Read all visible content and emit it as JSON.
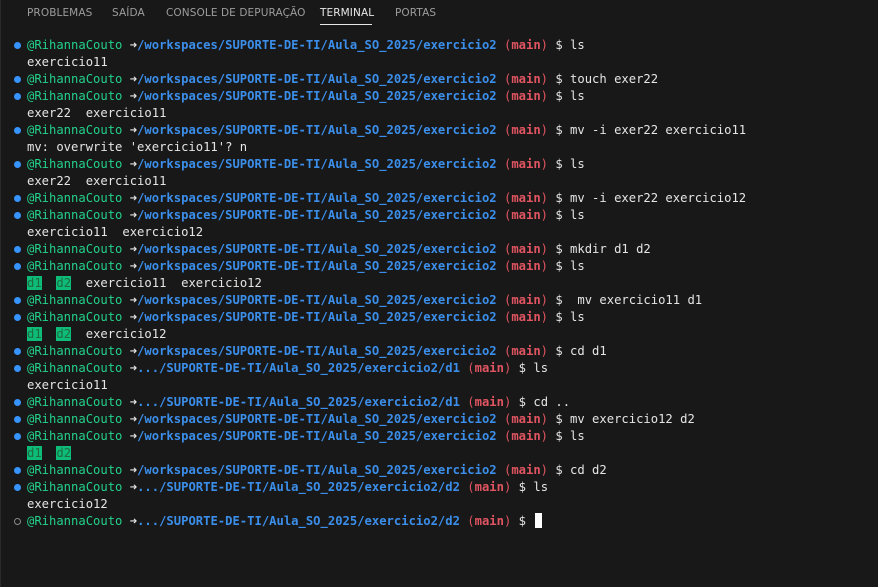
{
  "panel": {
    "tabs": [
      {
        "label": "PROBLEMAS"
      },
      {
        "label": "SAÍDA"
      },
      {
        "label": "CONSOLE DE DEPURAÇÃO"
      },
      {
        "label": "TERMINAL"
      },
      {
        "label": "PORTAS"
      }
    ],
    "active_tab": "TERMINAL"
  },
  "terminal": {
    "colors": {
      "user": "#23d18b",
      "path": "#3b8eea",
      "branch": "#e05561",
      "directory_highlight": "#0dbc79",
      "status_dot": "#3794ff"
    },
    "prompt": {
      "user": "@RihannaCouto",
      "arrow": "➜",
      "path_full": "/workspaces/SUPORTE-DE-TI/Aula_SO_2025/exercicio2",
      "path_d1": ".../SUPORTE-DE-TI/Aula_SO_2025/exercicio2/d1",
      "path_d2": ".../SUPORTE-DE-TI/Aula_SO_2025/exercicio2/d2",
      "branch": "main",
      "symbol": "$"
    },
    "lines": [
      {
        "cmd": "ls"
      },
      {
        "out": "exercicio11"
      },
      {
        "cmd": "touch exer22"
      },
      {
        "cmd": "ls"
      },
      {
        "out": "exer22  exercicio11"
      },
      {
        "cmd": "mv -i exer22 exercicio11"
      },
      {
        "out": "mv: overwrite 'exercicio11'? n"
      },
      {
        "cmd": "ls"
      },
      {
        "out": "exer22  exercicio11"
      },
      {
        "cmd": "mv -i exer22 exercicio12"
      },
      {
        "cmd": "ls"
      },
      {
        "out": "exercicio11  exercicio12"
      },
      {
        "cmd": "mkdir d1 d2"
      },
      {
        "cmd": "ls"
      },
      {
        "dirs": [
          "d1",
          "d2"
        ],
        "rest": "  exercicio11  exercicio12"
      },
      {
        "cmd": " mv exercicio11 d1"
      },
      {
        "cmd": "ls"
      },
      {
        "dirs": [
          "d1",
          "d2"
        ],
        "rest": "  exercicio12"
      },
      {
        "cmd": "cd d1"
      },
      {
        "cmd": "ls",
        "path": "d1"
      },
      {
        "out": "exercicio11"
      },
      {
        "cmd": "cd ..",
        "path": "d1"
      },
      {
        "cmd": "mv exercicio12 d2"
      },
      {
        "cmd": "ls"
      },
      {
        "dirs": [
          "d1",
          "d2"
        ],
        "rest": ""
      },
      {
        "cmd": "cd d2"
      },
      {
        "cmd": "ls",
        "path": "d2"
      },
      {
        "out": "exercicio12"
      },
      {
        "cmd": "",
        "path": "d2",
        "current": true
      }
    ]
  }
}
